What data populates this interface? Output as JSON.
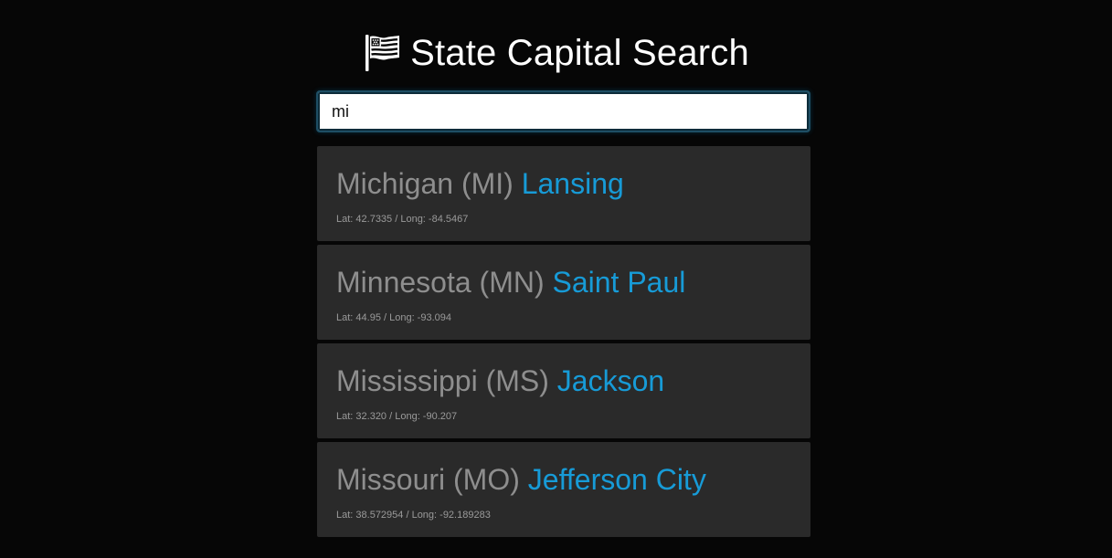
{
  "header": {
    "title": "State Capital Search",
    "icon": "flag-icon"
  },
  "search": {
    "value": "mi"
  },
  "colors": {
    "background": "#060606",
    "card": "#2a2a2a",
    "state_text": "#8e8e8e",
    "capital_text": "#179bd7"
  },
  "results": [
    {
      "state": "Michigan (MI)",
      "capital": "Lansing",
      "coords": "Lat: 42.7335 / Long: -84.5467"
    },
    {
      "state": "Minnesota (MN)",
      "capital": "Saint Paul",
      "coords": "Lat: 44.95 / Long: -93.094"
    },
    {
      "state": "Mississippi (MS)",
      "capital": "Jackson",
      "coords": "Lat: 32.320 / Long: -90.207"
    },
    {
      "state": "Missouri (MO)",
      "capital": "Jefferson City",
      "coords": "Lat: 38.572954 / Long: -92.189283"
    }
  ]
}
